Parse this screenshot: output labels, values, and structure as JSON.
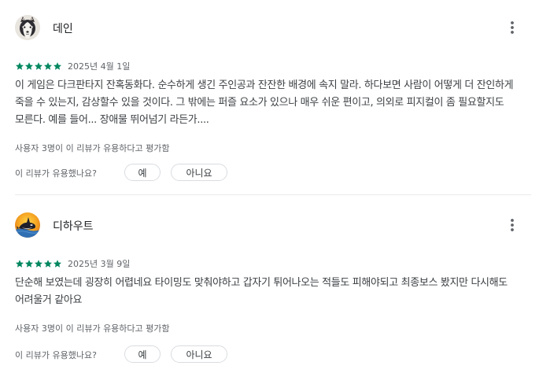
{
  "reviews": [
    {
      "reviewer": "데인",
      "avatar_icon": "husky-dog-avatar-icon",
      "rating": 5,
      "rating_max": 5,
      "date": "2025년 4월 1일",
      "body": "이 게임은 다크판타지 잔혹동화다. 순수하게 생긴 주인공과 잔잔한 배경에 속지 말라. 하다보면 사람이 어떻게 더 잔인하게 죽을 수 있는지, 감상할수 있을 것이다. 그 밖에는 퍼즐 요소가 있으나 매우 쉬운 편이고, 의외로 피지컬이 좀 필요할지도 모른다. 예를 들어... 장애물 뛰어넘기 라든가....",
      "helpful_count": "사용자 3명이 이 리뷰가 유용하다고 평가함",
      "helpful_question": "이 리뷰가 유용했나요?",
      "yes_label": "예",
      "no_label": "아니요"
    },
    {
      "reviewer": "디하우트",
      "avatar_icon": "orca-whale-avatar-icon",
      "rating": 5,
      "rating_max": 5,
      "date": "2025년 3월 9일",
      "body": "단순해 보였는데 굉장히 어렵네요 타이밍도 맞춰야하고 갑자기 튀어나오는 적들도 피해야되고 최종보스 봤지만 다시해도 어려울거 같아요",
      "helpful_count": "사용자 3명이 이 리뷰가 유용하다고 평가함",
      "helpful_question": "이 리뷰가 유용했나요?",
      "yes_label": "예",
      "no_label": "아니요"
    }
  ],
  "colors": {
    "star": "#01875f",
    "text_primary": "#202124",
    "text_secondary": "#5f6368",
    "body_text": "#3c4043",
    "border": "#dadce0",
    "divider": "#e8eaed"
  },
  "icons": {
    "more": "more-vert-icon",
    "star": "star-icon"
  }
}
